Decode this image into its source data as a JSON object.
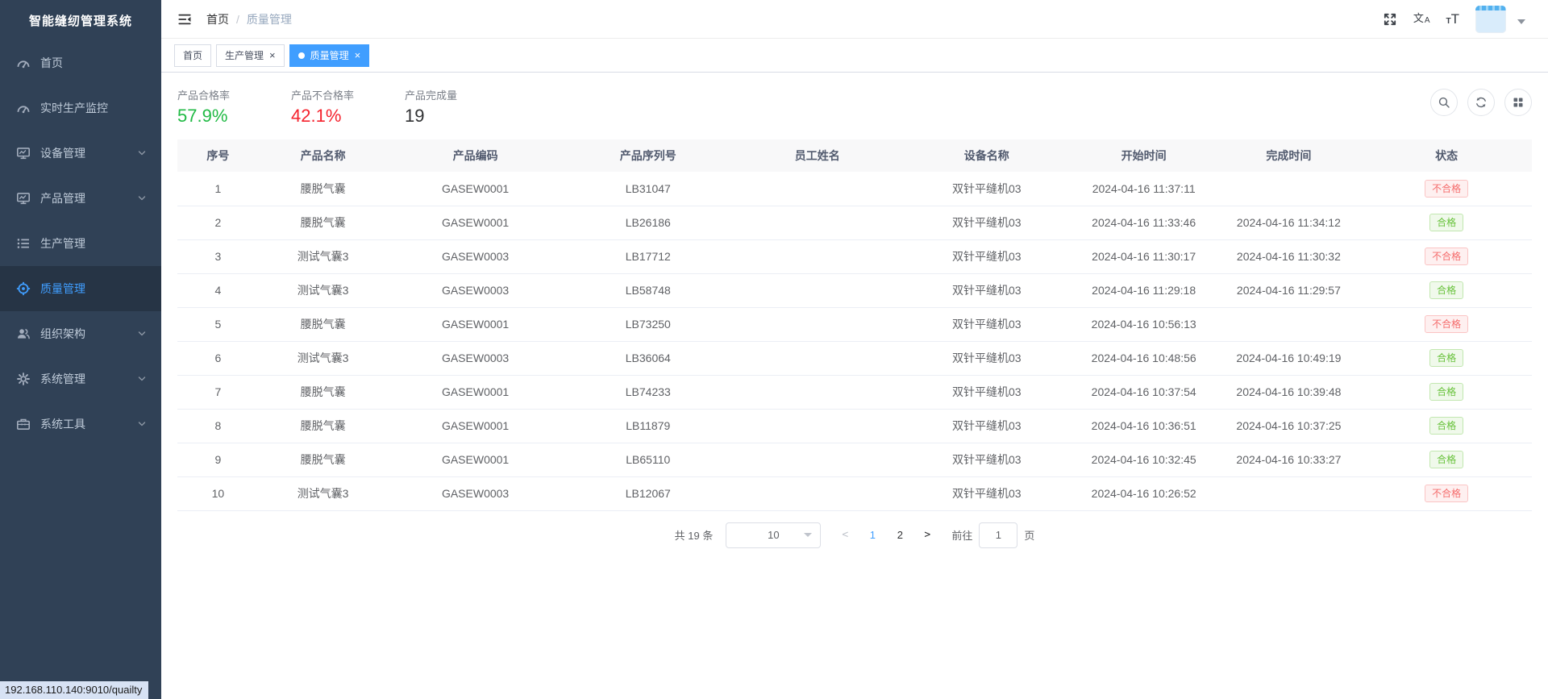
{
  "app": {
    "title": "智能缝纫管理系统"
  },
  "sidebar": {
    "items": [
      {
        "label": "首页",
        "icon": "dashboard-icon",
        "active": false,
        "expandable": false
      },
      {
        "label": "实时生产监控",
        "icon": "dashboard-icon",
        "active": false,
        "expandable": false
      },
      {
        "label": "设备管理",
        "icon": "device-monitor-icon",
        "active": false,
        "expandable": true
      },
      {
        "label": "产品管理",
        "icon": "product-monitor-icon",
        "active": false,
        "expandable": true
      },
      {
        "label": "生产管理",
        "icon": "production-list-icon",
        "active": false,
        "expandable": false
      },
      {
        "label": "质量管理",
        "icon": "quality-aim-icon",
        "active": true,
        "expandable": false
      },
      {
        "label": "组织架构",
        "icon": "org-users-icon",
        "active": false,
        "expandable": true
      },
      {
        "label": "系统管理",
        "icon": "system-gear-icon",
        "active": false,
        "expandable": true
      },
      {
        "label": "系统工具",
        "icon": "tools-box-icon",
        "active": false,
        "expandable": true
      }
    ]
  },
  "navbar": {
    "breadcrumb": {
      "items": [
        "首页",
        "质量管理"
      ],
      "separator": "/"
    }
  },
  "tabs": [
    {
      "label": "首页",
      "closable": false,
      "active": false
    },
    {
      "label": "生产管理",
      "closable": true,
      "active": false
    },
    {
      "label": "质量管理",
      "closable": true,
      "active": true
    }
  ],
  "stats": [
    {
      "label": "产品合格率",
      "value": "57.9%",
      "color": "#21ba45"
    },
    {
      "label": "产品不合格率",
      "value": "42.1%",
      "color": "#f5222d"
    },
    {
      "label": "产品完成量",
      "value": "19",
      "color": "#303133"
    }
  ],
  "toolbar": {
    "icons": [
      {
        "name": "search-icon"
      },
      {
        "name": "refresh-icon"
      },
      {
        "name": "grid-columns-icon"
      }
    ]
  },
  "table": {
    "columns": [
      "序号",
      "产品名称",
      "产品编码",
      "产品序列号",
      "员工姓名",
      "设备名称",
      "开始时间",
      "完成时间",
      "状态"
    ],
    "rows": [
      [
        "1",
        "腰脱气囊",
        "GASEW0001",
        "LB31047",
        "",
        "双针平缝机03",
        "2024-04-16 11:37:11",
        "",
        "不合格"
      ],
      [
        "2",
        "腰脱气囊",
        "GASEW0001",
        "LB26186",
        "",
        "双针平缝机03",
        "2024-04-16 11:33:46",
        "2024-04-16 11:34:12",
        "合格"
      ],
      [
        "3",
        "测试气囊3",
        "GASEW0003",
        "LB17712",
        "",
        "双针平缝机03",
        "2024-04-16 11:30:17",
        "2024-04-16 11:30:32",
        "不合格"
      ],
      [
        "4",
        "测试气囊3",
        "GASEW0003",
        "LB58748",
        "",
        "双针平缝机03",
        "2024-04-16 11:29:18",
        "2024-04-16 11:29:57",
        "合格"
      ],
      [
        "5",
        "腰脱气囊",
        "GASEW0001",
        "LB73250",
        "",
        "双针平缝机03",
        "2024-04-16 10:56:13",
        "",
        "不合格"
      ],
      [
        "6",
        "测试气囊3",
        "GASEW0003",
        "LB36064",
        "",
        "双针平缝机03",
        "2024-04-16 10:48:56",
        "2024-04-16 10:49:19",
        "合格"
      ],
      [
        "7",
        "腰脱气囊",
        "GASEW0001",
        "LB74233",
        "",
        "双针平缝机03",
        "2024-04-16 10:37:54",
        "2024-04-16 10:39:48",
        "合格"
      ],
      [
        "8",
        "腰脱气囊",
        "GASEW0001",
        "LB11879",
        "",
        "双针平缝机03",
        "2024-04-16 10:36:51",
        "2024-04-16 10:37:25",
        "合格"
      ],
      [
        "9",
        "腰脱气囊",
        "GASEW0001",
        "LB65110",
        "",
        "双针平缝机03",
        "2024-04-16 10:32:45",
        "2024-04-16 10:33:27",
        "合格"
      ],
      [
        "10",
        "测试气囊3",
        "GASEW0003",
        "LB12067",
        "",
        "双针平缝机03",
        "2024-04-16 10:26:52",
        "",
        "不合格"
      ]
    ]
  },
  "badges": {
    "pass": "合格",
    "fail": "不合格",
    "pass_color": "#67c23a",
    "fail_color": "#f56c6c"
  },
  "pagination": {
    "total_text": "共 19 条",
    "page_size": "10",
    "pages": [
      "1",
      "2"
    ],
    "active_page": "1",
    "prev_label": "<",
    "next_label": ">",
    "goto_label": "前往",
    "goto_value": "1",
    "unit_label": "页"
  },
  "statusbar": {
    "url": "192.168.110.140:9010/quailty"
  }
}
